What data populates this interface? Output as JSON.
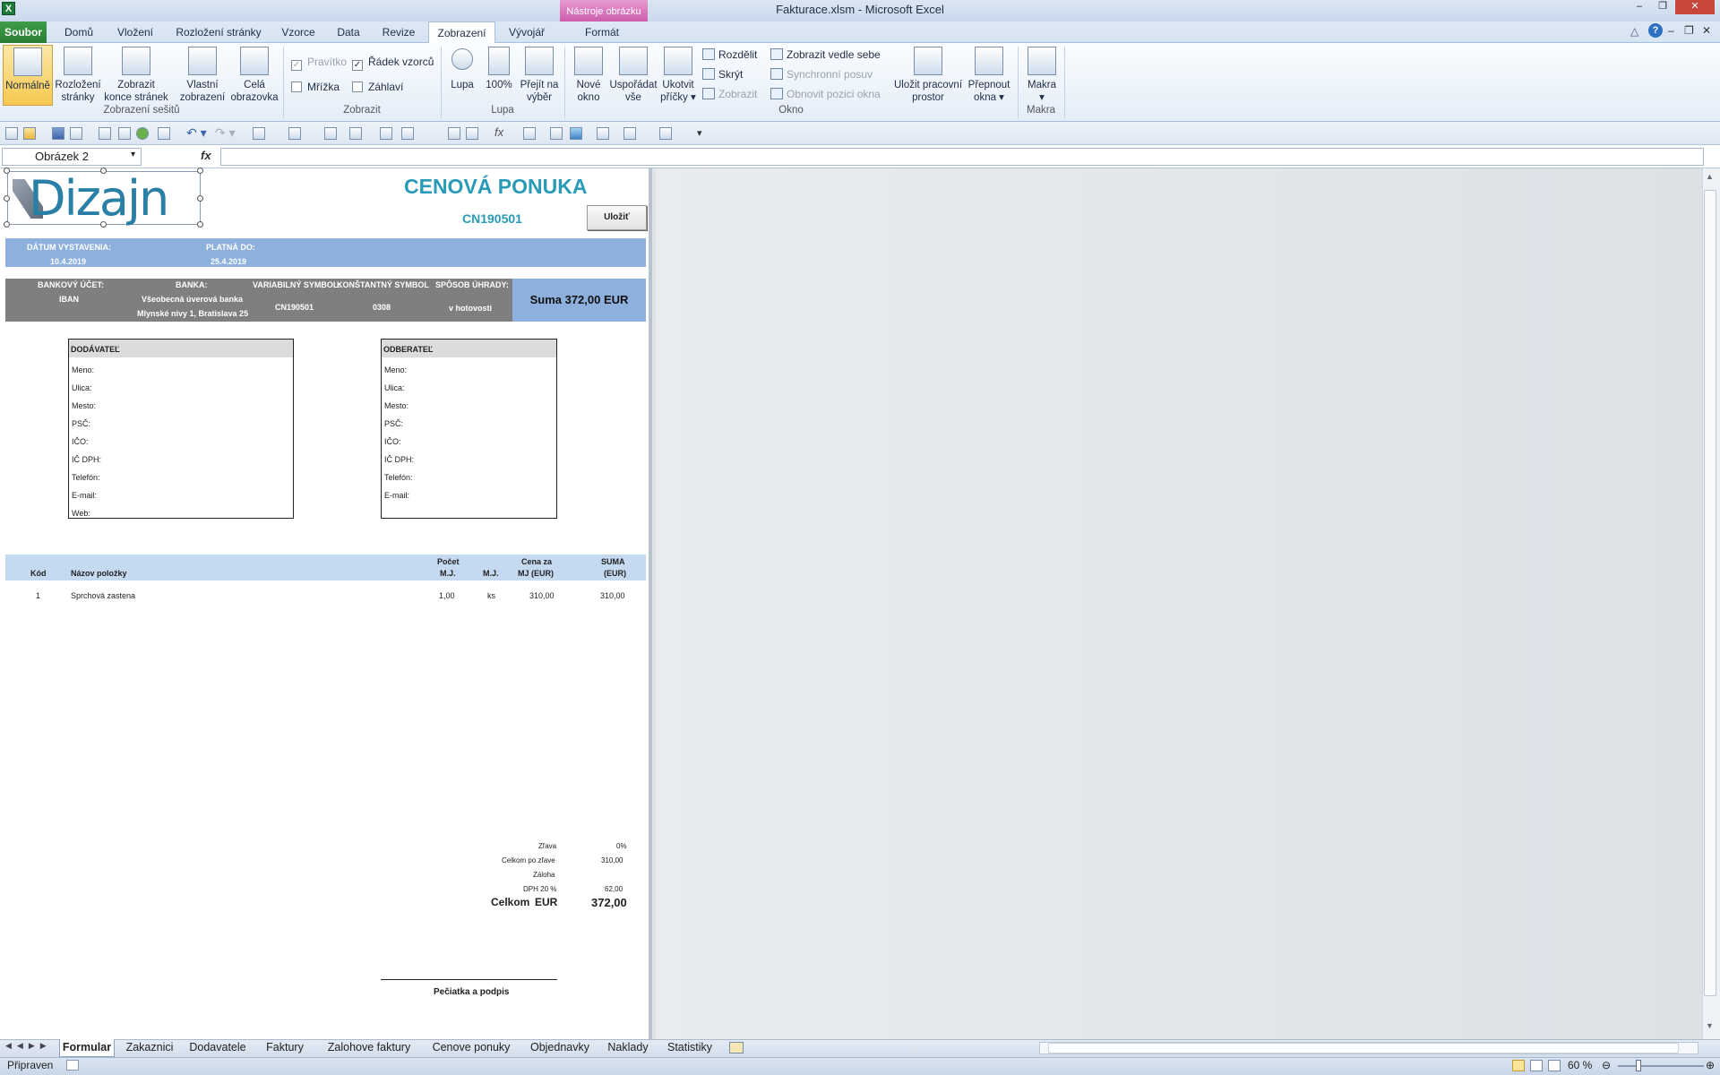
{
  "window": {
    "title": "Fakturace.xlsm  -  Microsoft Excel",
    "context_header": "Nástroje obrázku"
  },
  "tabs": [
    "Soubor",
    "Domů",
    "Vložení",
    "Rozložení stránky",
    "Vzorce",
    "Data",
    "Revize",
    "Zobrazení",
    "Vývojář",
    "Formát"
  ],
  "ribbon": {
    "workbook_views": {
      "label": "Zobrazení sešitů",
      "normal": "Normálně",
      "page_layout": [
        "Rozložení",
        "stránky"
      ],
      "page_break": [
        "Zobrazit",
        "konce stránek"
      ],
      "custom": [
        "Vlastní",
        "zobrazení"
      ],
      "full": [
        "Celá",
        "obrazovka"
      ]
    },
    "show": {
      "label": "Zobrazit",
      "ruler": "Pravítko",
      "formula_bar": "Řádek vzorců",
      "gridlines": "Mřížka",
      "headings": "Záhlaví"
    },
    "zoom": {
      "label": "Lupa",
      "zoom": "Lupa",
      "hundred": "100%",
      "selection": [
        "Přejít na",
        "výběr"
      ]
    },
    "window": {
      "label": "Okno",
      "new": [
        "Nové",
        "okno"
      ],
      "arrange": [
        "Uspořádat",
        "vše"
      ],
      "freeze": [
        "Ukotvit",
        "příčky"
      ],
      "split": "Rozdělit",
      "hide": "Skrýt",
      "unhide": "Zobrazit",
      "side_by_side": "Zobrazit vedle sebe",
      "sync": "Synchronní posuv",
      "reset": "Obnovit pozici okna",
      "save_ws": [
        "Uložit pracovní",
        "prostor"
      ],
      "switch": [
        "Přepnout",
        "okna"
      ]
    },
    "macros": {
      "label": "Makra",
      "macros": "Makra"
    }
  },
  "formula_bar": {
    "name_box": "Obrázek 2",
    "fx": "fx"
  },
  "invoice": {
    "logo": "Dizajn",
    "title": "CENOVÁ PONUKA",
    "number": "CN190501",
    "save_button": "Uložiť",
    "date_issued_label": "DÁTUM VYSTAVENIA:",
    "date_issued": "10.4.2019",
    "valid_to_label": "PLATNÁ DO:",
    "valid_to": "25.4.2019",
    "bank_account_label": "BANKOVÝ ÚČET:",
    "bank_account": "IBAN",
    "bank_label": "BANKA:",
    "bank_name": "Všeobecná úverová banka",
    "bank_address": "Mlynské nivy 1, Bratislava 25",
    "vs_label": "VARIABILNÝ SYMBOL:",
    "vs": "CN190501",
    "ks_label": "KONŠTANTNÝ SYMBOL",
    "ks": "0308",
    "payment_label": "SPÔSOB ÚHRADY:",
    "payment": "v hotovosti",
    "sum": "Suma 372,00 EUR",
    "supplier": {
      "title": "DODÁVATEĽ",
      "rows": [
        "Meno:",
        "Ulica:",
        "Mesto:",
        "PSČ:",
        "IČO:",
        "IČ DPH:",
        "Telefón:",
        "E-mail:",
        "Web:"
      ]
    },
    "customer": {
      "title": "ODBERATEĽ",
      "rows": [
        "Meno:",
        "Ulica:",
        "Mesto:",
        "PSČ:",
        "IČO:",
        "IČ DPH:",
        "Telefón:",
        "E-mail:"
      ]
    },
    "items_header": {
      "code": "Kód",
      "name": "Názov položky",
      "count": [
        "Počet",
        "M.J."
      ],
      "unit": "M.J.",
      "price": [
        "Cena za",
        "MJ (EUR)"
      ],
      "sum": [
        "SUMA",
        "(EUR)"
      ]
    },
    "items": [
      {
        "code": "1",
        "name": "Sprchová zastena",
        "count": "1,00",
        "unit": "ks",
        "price": "310,00",
        "sum": "310,00"
      }
    ],
    "totals": {
      "discount_label": "Zľava",
      "discount": "0%",
      "after_discount_label": "Celkom po zľave",
      "after_discount": "310,00",
      "deposit_label": "Záloha",
      "vat_label": "DPH 20 %",
      "vat": "62,00",
      "total_label": "Celkom",
      "currency": "EUR",
      "total": "372,00"
    },
    "signature": "Pečiatka a podpis"
  },
  "sheet_tabs": [
    "Formular",
    "Zakaznici",
    "Dodavatele",
    "Faktury",
    "Zalohove faktury",
    "Cenove ponuky",
    "Objednavky",
    "Naklady",
    "Statistiky"
  ],
  "status": {
    "ready": "Připraven",
    "zoom": "60 %"
  },
  "colors": {
    "excel_green": "#2a7d33",
    "title_blue": "#2a9bb6",
    "header_blue": "#8db0dc",
    "bank_gray": "#7f7f7f",
    "items_header": "#c5d9f0"
  }
}
